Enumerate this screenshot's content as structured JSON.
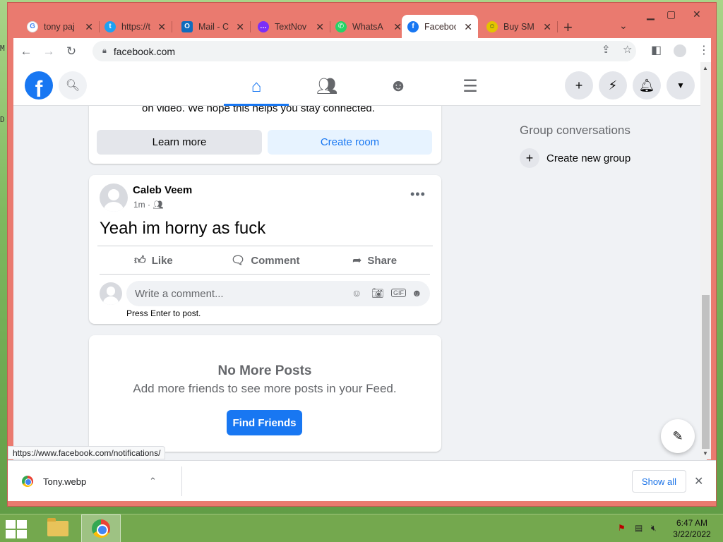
{
  "browser": {
    "tabs": [
      {
        "title": "tony paj",
        "favicon": "google-g",
        "color": "#ffffff"
      },
      {
        "title": "https://t",
        "favicon": "twitter-bird",
        "color": "#1da1f2"
      },
      {
        "title": "Mail - C",
        "favicon": "outlook-o",
        "color": "#0f6cbd"
      },
      {
        "title": "TextNov",
        "favicon": "textnow-bubble",
        "color": "#7b2ff7"
      },
      {
        "title": "WhatsA",
        "favicon": "whatsapp-phone",
        "color": "#25d366"
      },
      {
        "title": "Faceboo",
        "favicon": "facebook-f",
        "color": "#1877f2"
      },
      {
        "title": "Buy SM",
        "favicon": "smile-coin",
        "color": "#e4c300"
      }
    ],
    "new_tab": "+",
    "address": "facebook.com",
    "status_url": "https://www.facebook.com/notifications/"
  },
  "facebook": {
    "logo": "f",
    "top_card": {
      "clip_text": "on video. We hope this helps you stay connected.",
      "learn_more": "Learn more",
      "create_room": "Create room"
    },
    "post": {
      "author": "Caleb Veem",
      "time": "1m",
      "text": "Yeah im horny as fuck",
      "like": "Like",
      "comment": "Comment",
      "share": "Share",
      "comment_placeholder": "Write a comment...",
      "press_enter": "Press Enter to post."
    },
    "end_card": {
      "title": "No More Posts",
      "subtitle": "Add more friends to see more posts in your Feed.",
      "button": "Find Friends"
    },
    "right_rail": {
      "group_title": "Group conversations",
      "create_group": "Create new group"
    },
    "colors": {
      "brand": "#1877f2",
      "background": "#f0f2f5"
    }
  },
  "downloads": {
    "file": "Tony.webp",
    "show_all": "Show all"
  },
  "taskbar": {
    "time": "6:47 AM",
    "date": "3/22/2022"
  }
}
